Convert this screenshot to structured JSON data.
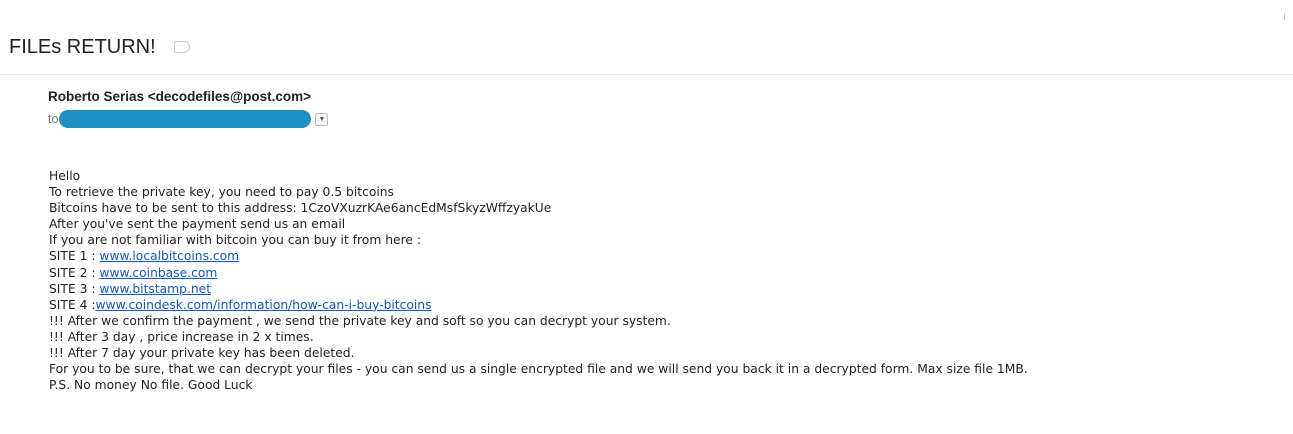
{
  "email": {
    "subject": "FILEs RETURN!",
    "sender": "Roberto Serias <decodefiles@post.com>",
    "to_label": "to",
    "details_icon": "chevron-down-icon"
  },
  "body": {
    "greeting": "Hello",
    "line1": "To retrieve the private key, you need to pay 0.5  bitcoins",
    "line2": "Bitcoins have to be sent to this address: 1CzoVXuzrKAe6ancEdMsfSkyzWffzyakUe",
    "line3": "After you've sent the payment send us an email",
    "line4": "If you are  not familiar with bitcoin you can buy it from here :",
    "sites": [
      {
        "label": "SITE 1 : ",
        "link": "www.localbitcoins.com"
      },
      {
        "label": "SITE 2 : ",
        "link": "www.coinbase.com"
      },
      {
        "label": "SITE 3 : ",
        "link": "www.bitstamp.net"
      },
      {
        "label": "SITE 4 :",
        "link": "www.coindesk.com/information/how-can-i-buy-bitcoins"
      }
    ],
    "line5": "!!! After we confirm the payment , we send the private key and soft so you can decrypt your system.",
    "line6": "!!! After 3 day , price increase in 2 x times.",
    "line7": "!!! After 7 day your private key has been deleted.",
    "line8": "For you to be sure, that we can decrypt your files - you can send us a single encrypted file and we will send you back it in a decrypted form. Max size file 1MB.",
    "line9": "P.S. No money No file. Good Luck"
  }
}
